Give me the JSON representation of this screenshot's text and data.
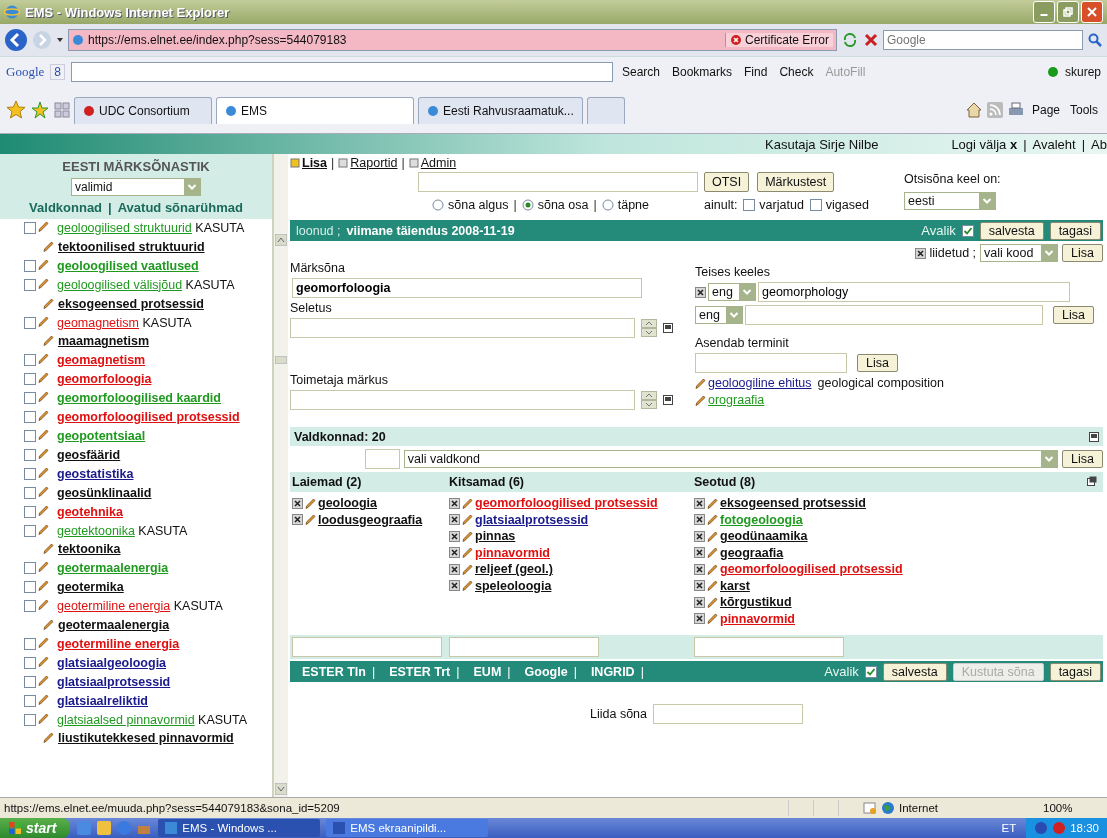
{
  "browser": {
    "title": "EMS - Windows Internet Explorer",
    "url": "https://ems.elnet.ee/index.php?sess=544079183",
    "cert_error": "Certificate Error",
    "search_placeholder": "Google",
    "google_toolbar": {
      "brand": "Google",
      "button": "8",
      "items": [
        {
          "label": "Search",
          "disabled": false
        },
        {
          "label": "Bookmarks",
          "disabled": false
        },
        {
          "label": "Find",
          "disabled": false
        },
        {
          "label": "Check",
          "disabled": false
        },
        {
          "label": "AutoFill",
          "disabled": true
        }
      ],
      "account": "skurep"
    },
    "tabs": [
      {
        "label": "UDC Consortium",
        "selected": false
      },
      {
        "label": "EMS",
        "selected": true
      },
      {
        "label": "Eesti Rahvusraamatuk...",
        "selected": false
      }
    ],
    "commands": [
      "Page",
      "Tools"
    ],
    "status": {
      "url": "https://ems.elnet.ee/muuda.php?sess=544079183&sona_id=5209",
      "zone": "Internet",
      "zoom": "100%"
    }
  },
  "header": {
    "user": "Kasutaja Sirje Nilbe",
    "separator": "|",
    "links": [
      "Logi välja **x**",
      "Avaleht",
      "Ab"
    ]
  },
  "sidebar": {
    "title": "EESTI MÄRKSÕNASTIK",
    "select": "valimid",
    "separator": "|",
    "links": [
      "Valdkonnad",
      "Avatud sõnarühmad"
    ],
    "entries": [
      {
        "kind": "use",
        "term": "geoloogilised struktuurid",
        "use_label": "KASUTA",
        "target": "tektoonilised struktuurid",
        "color": "#1f9a1f",
        "checked": false
      },
      {
        "kind": "term",
        "term": "geoloogilised vaatlused",
        "color": "#1f9a1f",
        "checked": false
      },
      {
        "kind": "use",
        "term": "geoloogilised välisjõud",
        "use_label": "KASUTA",
        "target": "eksogeensed protsessid",
        "color": "#1f9a1f",
        "checked": false
      },
      {
        "kind": "use",
        "term": "geomagnetism",
        "use_label": "KASUTA",
        "target": "maamagnetism",
        "color": "#e01010",
        "checked": false
      },
      {
        "kind": "term",
        "term": "geomagnetism",
        "color": "#e01010",
        "checked": false
      },
      {
        "kind": "term",
        "term": "geomorfoloogia",
        "color": "#e01010",
        "checked": false
      },
      {
        "kind": "term",
        "term": "geomorfoloogilised kaardid",
        "color": "#1f9a1f",
        "checked": false
      },
      {
        "kind": "term",
        "term": "geomorfoloogilised protsessid",
        "color": "#e01010",
        "checked": false
      },
      {
        "kind": "term",
        "term": "geopotentsiaal",
        "color": "#1f9a1f",
        "checked": false
      },
      {
        "kind": "term",
        "term": "geosfäärid",
        "color": "#111111",
        "checked": false
      },
      {
        "kind": "term",
        "term": "geostatistika",
        "color": "#1a1a8c",
        "checked": false
      },
      {
        "kind": "term",
        "term": "geosünklinaalid",
        "color": "#111111",
        "checked": false
      },
      {
        "kind": "term",
        "term": "geotehnika",
        "color": "#e01010",
        "checked": false
      },
      {
        "kind": "use",
        "term": "geotektoonika",
        "use_label": "KASUTA",
        "target": "tektoonika",
        "color": "#1f9a1f",
        "checked": false
      },
      {
        "kind": "term",
        "term": "geotermaalenergia",
        "color": "#1f9a1f",
        "checked": false
      },
      {
        "kind": "term",
        "term": "geotermika",
        "color": "#111111",
        "checked": false
      },
      {
        "kind": "use",
        "term": "geotermiline energia",
        "use_label": "KASUTA",
        "target": "geotermaalenergia",
        "color": "#e01010",
        "checked": false
      },
      {
        "kind": "term",
        "term": "geotermiline energia",
        "color": "#e01010",
        "checked": false
      },
      {
        "kind": "term",
        "term": "glatsiaalgeoloogia",
        "color": "#1a1a8c",
        "checked": false
      },
      {
        "kind": "term",
        "term": "glatsiaalprotsessid",
        "color": "#1a1a8c",
        "checked": false
      },
      {
        "kind": "term",
        "term": "glatsiaalreliktid",
        "color": "#1a1a8c",
        "checked": false
      },
      {
        "kind": "use",
        "term": "glatsiaalsed pinnavormid",
        "use_label": "KASUTA",
        "target": "liustikutekkesed pinnavormid",
        "color": "#1f9a1f",
        "checked": false
      }
    ]
  },
  "menu": {
    "separator": "|",
    "links": [
      {
        "label": "Lisa",
        "selected": true
      },
      {
        "label": "Raportid",
        "selected": false
      },
      {
        "label": "Admin",
        "selected": false
      }
    ]
  },
  "search": {
    "buttons": [
      "OTSI",
      "Märkustest"
    ],
    "language_label": "Otsisõna keel on:",
    "language": "eesti",
    "separator": "|",
    "match_options": [
      {
        "label": "sõna algus",
        "selected": false
      },
      {
        "label": "sõna osa",
        "selected": true
      },
      {
        "label": "täpne",
        "selected": false
      }
    ],
    "only_label": "ainult:",
    "only_options": [
      {
        "label": "varjatud",
        "checked": false
      },
      {
        "label": "vigased",
        "checked": false
      }
    ]
  },
  "record": {
    "created": "loonud ;",
    "updated": "viimane täiendus 2008-11-19",
    "public_label": "Avalik",
    "public": true,
    "buttons": [
      "salvesta",
      "tagasi"
    ]
  },
  "form": {
    "term_label": "Märksõna",
    "term": "geomorfoloogia",
    "explanation_label": "Seletus",
    "note_label": "Toimetaja märkus",
    "merged": {
      "label": "liidetud ;",
      "select": "vali kood",
      "button": "Lisa"
    },
    "translations_label": "Teises keeles",
    "translations": [
      {
        "lang": "eng",
        "value": "geomorphology"
      }
    ],
    "new_translation": {
      "lang": "eng",
      "button": "Lisa"
    },
    "replaces_label": "Asendab terminit",
    "replaces_button": "Lisa",
    "replaced_terms": [
      {
        "term": "geoloogiline ehitus",
        "note": "geological composition",
        "color": "#1a1a8c"
      },
      {
        "term": "orograafia",
        "color": "#1f9a1f"
      }
    ]
  },
  "domains": {
    "label": "Valdkonnad: 20",
    "select": "vali valdkond",
    "button": "Lisa"
  },
  "relations": [
    {
      "title": "Laiemad (2)",
      "terms": [
        {
          "term": "geoloogia",
          "color": "#111111"
        },
        {
          "term": "loodusgeograafia",
          "color": "#111111"
        }
      ]
    },
    {
      "title": "Kitsamad (6)",
      "terms": [
        {
          "term": "geomorfoloogilised protsessid",
          "color": "#e01010"
        },
        {
          "term": "glatsiaalprotsessid",
          "color": "#1a1a8c"
        },
        {
          "term": "pinnas",
          "color": "#111111"
        },
        {
          "term": "pinnavormid",
          "color": "#e01010"
        },
        {
          "term": "reljeef (geol.)",
          "color": "#111111"
        },
        {
          "term": "speleoloogia",
          "color": "#111111"
        }
      ]
    },
    {
      "title": "Seotud (8)",
      "terms": [
        {
          "term": "eksogeensed protsessid",
          "color": "#111111"
        },
        {
          "term": "fotogeoloogia",
          "color": "#1f9a1f"
        },
        {
          "term": "geodünaamika",
          "color": "#111111"
        },
        {
          "term": "geograafia",
          "color": "#111111"
        },
        {
          "term": "geomorfoloogilised protsessid",
          "color": "#e01010"
        },
        {
          "term": "karst",
          "color": "#111111"
        },
        {
          "term": "kõrgustikud",
          "color": "#111111"
        },
        {
          "term": "pinnavormid",
          "color": "#e01010"
        }
      ]
    }
  ],
  "footer": {
    "separator": "|",
    "links": [
      "ESTER Tln",
      "ESTER Trt",
      "EUM",
      "Google",
      "INGRID"
    ],
    "public_label": "Avalik",
    "public": true,
    "buttons": [
      {
        "label": "salvesta",
        "disabled": false
      },
      {
        "label": "Kustuta sõna",
        "disabled": true
      },
      {
        "label": "tagasi",
        "disabled": false
      }
    ]
  },
  "merge": {
    "label": "Liida sõna"
  },
  "taskbar": {
    "start": "start",
    "items": [
      {
        "label": "EMS - Windows ...",
        "selected": true
      },
      {
        "label": "EMS ekraanipildi...",
        "selected": false
      }
    ],
    "language": "ET",
    "clock": "18:30"
  }
}
